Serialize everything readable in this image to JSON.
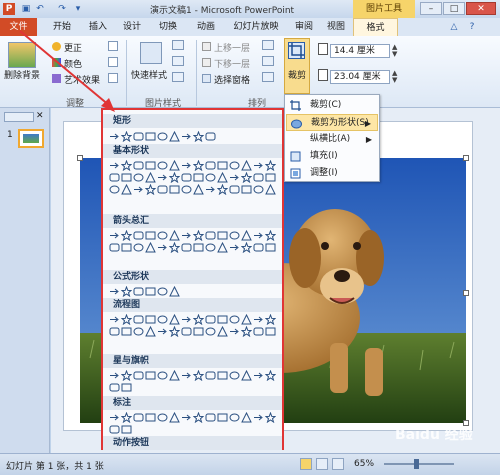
{
  "window": {
    "title": "演示文稿1 - Microsoft PowerPoint",
    "context_tab_group": "图片工具"
  },
  "tabs": [
    "文件",
    "开始",
    "插入",
    "设计",
    "切换",
    "动画",
    "幻灯片放映",
    "审阅",
    "视图",
    "格式"
  ],
  "ribbon": {
    "remove_bg": "删除背景",
    "corrections": "更正",
    "color": "颜色",
    "artistic": "艺术效果",
    "adjust_group": "调整",
    "quick_styles": "快速样式",
    "picture_styles_group": "图片样式",
    "bring_forward": "上移一层",
    "send_backward": "下移一层",
    "selection_pane": "选择窗格",
    "arrange_group": "排列",
    "crop": "裁剪",
    "height_value": "14.4 厘米",
    "width_value": "23.04 厘米"
  },
  "slide_panel": {
    "slide_number": "1"
  },
  "gallery": {
    "categories": [
      "矩形",
      "基本形状",
      "箭头总汇",
      "公式形状",
      "流程图",
      "星与旗帜",
      "标注",
      "动作按钮"
    ]
  },
  "crop_menu": {
    "items": [
      {
        "label": "裁剪(C)"
      },
      {
        "label": "裁剪为形状(S)"
      },
      {
        "label": "纵横比(A)"
      },
      {
        "label": "填充(I)"
      },
      {
        "label": "调整(I)"
      }
    ]
  },
  "statusbar": {
    "slide_info": "幻灯片 第 1 张，共 1 张",
    "zoom": "65%"
  },
  "watermark": "Baidu 经验",
  "colors": {
    "accent_red": "#e03535",
    "file_tab": "#d24b26",
    "context_tab": "#f6d46a"
  }
}
